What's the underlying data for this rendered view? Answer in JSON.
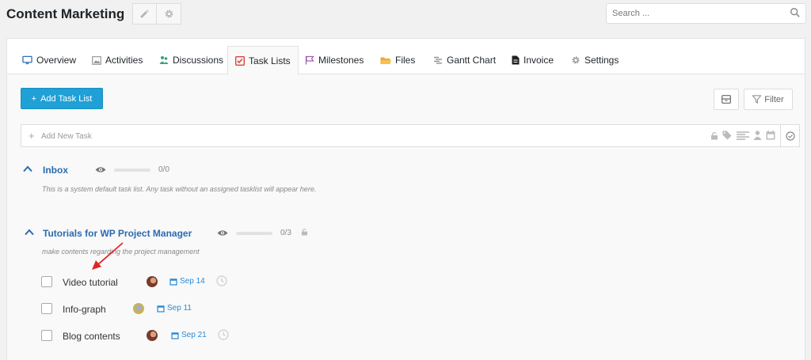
{
  "header": {
    "project_title": "Content Marketing",
    "icons": [
      "pencil-icon",
      "gear-icon"
    ],
    "search_placeholder": "Search ..."
  },
  "tabs": [
    {
      "label": "Overview",
      "icon": "monitor-icon"
    },
    {
      "label": "Activities",
      "icon": "image-icon"
    },
    {
      "label": "Discussions",
      "icon": "users-icon"
    },
    {
      "label": "Task Lists",
      "icon": "checklist-icon",
      "active": true
    },
    {
      "label": "Milestones",
      "icon": "flag-icon"
    },
    {
      "label": "Files",
      "icon": "folder-icon"
    },
    {
      "label": "Gantt Chart",
      "icon": "gantt-icon"
    },
    {
      "label": "Invoice",
      "icon": "document-icon"
    },
    {
      "label": "Settings",
      "icon": "gear-icon"
    }
  ],
  "toolbar": {
    "add_task_list": "Add Task List",
    "filter": "Filter"
  },
  "new_task": {
    "placeholder": "Add New Task"
  },
  "lists": [
    {
      "title": "Inbox",
      "progress": "0/0",
      "description": "This is a system default task list. Any task without an assigned tasklist will appear here.",
      "tasks": []
    },
    {
      "title": "Tutorials for WP Project Manager",
      "progress": "0/3",
      "description": "make contents regarding the project management",
      "tasks": [
        {
          "title": "Video tutorial",
          "due": "Sep 14"
        },
        {
          "title": "Info-graph",
          "due": "Sep 11"
        },
        {
          "title": "Blog contents",
          "due": "Sep 21"
        }
      ]
    }
  ],
  "colors": {
    "accent": "#1fa0d6",
    "link": "#2a6bb0",
    "due": "#2a8ad8",
    "annotation_arrow": "#e02424"
  }
}
